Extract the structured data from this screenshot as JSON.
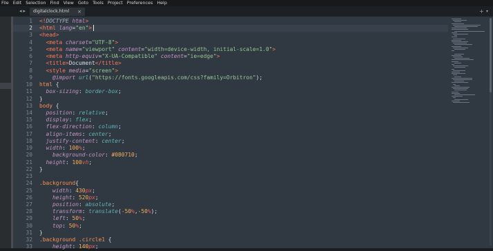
{
  "menu": [
    "File",
    "Edit",
    "Selection",
    "Find",
    "View",
    "Goto",
    "Tools",
    "Project",
    "Preferences",
    "Help"
  ],
  "tab": {
    "title": "digitalclock.html",
    "close": "×"
  },
  "nav": {
    "back": "◂",
    "forward": "▸",
    "new_tab": "+",
    "tab_menu": "▾"
  },
  "editor": {
    "active_line": 2,
    "lines": [
      {
        "n": "1",
        "html": "<span class=\"tg\">&lt;!</span><span class=\"cm\">DOCTYPE</span> <span class=\"pr\">html</span><span class=\"tg\">&gt;</span>"
      },
      {
        "n": "2",
        "html": "<span class=\"tg\">&lt;html</span> <span class=\"pr\">lang</span>=<span class=\"st\">\"en\"</span><span class=\"tg\">&gt;</span>"
      },
      {
        "n": "3",
        "html": "<span class=\"tg\">&lt;head&gt;</span>"
      },
      {
        "n": "4",
        "html": "  <span class=\"tg\">&lt;meta</span> <span class=\"pr\">charset</span>=<span class=\"st\">\"UTF-8\"</span><span class=\"tg\">&gt;</span>"
      },
      {
        "n": "5",
        "html": "  <span class=\"tg\">&lt;meta</span> <span class=\"pr\">name</span>=<span class=\"st\">\"viewport\"</span> <span class=\"pr\">content</span>=<span class=\"st\">\"width=device-width, initial-scale=1.0\"</span><span class=\"tg\">&gt;</span>"
      },
      {
        "n": "6",
        "html": "  <span class=\"tg\">&lt;meta</span> <span class=\"pr\">http-equiv</span>=<span class=\"st\">\"X-UA-Compatible\"</span> <span class=\"pr\">content</span>=<span class=\"st\">\"ie=edge\"</span><span class=\"tg\">&gt;</span>"
      },
      {
        "n": "7",
        "html": "  <span class=\"tg\">&lt;title&gt;</span>Document<span class=\"tg\">&lt;/title&gt;</span>"
      },
      {
        "n": "8",
        "html": "  <span class=\"tg\">&lt;style</span> <span class=\"pr\">media</span>=<span class=\"st\">\"screen\"</span><span class=\"tg\">&gt;</span>"
      },
      {
        "n": "9",
        "html": "    <span class=\"pr\">@import</span> <span class=\"va\">url</span>(<span class=\"st\">\"https://fonts.googleapis.com/css?family=Orbitron\"</span>);"
      },
      {
        "n": "10",
        "html": "<span class=\"se\">html</span> {"
      },
      {
        "n": "11",
        "html": "  <span class=\"pr\">box-sizing</span>: <span class=\"va\">border-box</span>;"
      },
      {
        "n": "12",
        "html": "}"
      },
      {
        "n": "13",
        "html": "<span class=\"se\">body</span> {"
      },
      {
        "n": "14",
        "html": "  <span class=\"pr\">position</span>: <span class=\"va\">relative</span>;"
      },
      {
        "n": "15",
        "html": "  <span class=\"pr\">display</span>: <span class=\"va\">flex</span>;"
      },
      {
        "n": "16",
        "html": "  <span class=\"pr\">flex-direction</span>: <span class=\"va\">column</span>;"
      },
      {
        "n": "17",
        "html": "  <span class=\"pr\">align-items</span>: <span class=\"va\">center</span>;"
      },
      {
        "n": "18",
        "html": "  <span class=\"pr\">justify-content</span>: <span class=\"va\">center</span>;"
      },
      {
        "n": "19",
        "html": "  <span class=\"pr\">width</span>: <span class=\"nu\">100</span><span class=\"un\">%</span>;"
      },
      {
        "n": "20",
        "html": "    <span class=\"pr\">background-color</span>: <span class=\"nu\">#080710</span>;"
      },
      {
        "n": "21",
        "html": "  <span class=\"pr\">height</span>: <span class=\"nu\">100</span><span class=\"un\">vh</span>;"
      },
      {
        "n": "22",
        "html": "}"
      },
      {
        "n": "23",
        "html": ""
      },
      {
        "n": "24",
        "html": "<span class=\"se\">.background</span>{"
      },
      {
        "n": "25",
        "html": "    <span class=\"pr\">width</span>: <span class=\"nu\">430</span><span class=\"un\">px</span>;"
      },
      {
        "n": "26",
        "html": "    <span class=\"pr\">height</span>: <span class=\"nu\">520</span><span class=\"un\">px</span>;"
      },
      {
        "n": "27",
        "html": "    <span class=\"pr\">position</span>: <span class=\"va\">absolute</span>;"
      },
      {
        "n": "28",
        "html": "    <span class=\"pr\">transform</span>: <span class=\"va\">translate</span>(<span class=\"nu\">-50</span><span class=\"un\">%</span>,<span class=\"nu\">-50</span><span class=\"un\">%</span>);"
      },
      {
        "n": "29",
        "html": "    <span class=\"pr\">left</span>: <span class=\"nu\">50</span><span class=\"un\">%</span>;"
      },
      {
        "n": "30",
        "html": "    <span class=\"pr\">top</span>: <span class=\"nu\">50</span><span class=\"un\">%</span>;"
      },
      {
        "n": "31",
        "html": "}"
      },
      {
        "n": "32",
        "html": "<span class=\"se\">.background .circle1</span> {"
      },
      {
        "n": "33",
        "html": "    <span class=\"pr\">height</span>: <span class=\"nu\">140</span><span class=\"un\">px</span>;"
      }
    ]
  }
}
